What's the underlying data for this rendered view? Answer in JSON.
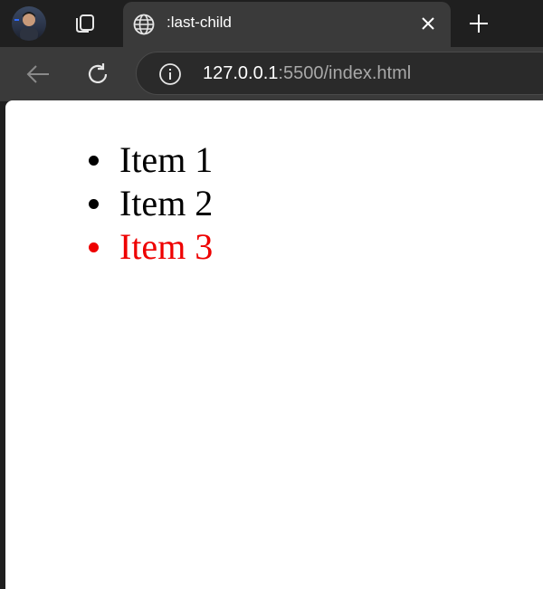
{
  "browser": {
    "tab": {
      "title": ":last-child"
    },
    "address_bar": {
      "host": "127.0.0.1",
      "rest": ":5500/index.html"
    }
  },
  "page": {
    "items": [
      "Item 1",
      "Item 2",
      "Item 3"
    ],
    "colors": {
      "default": "#000000",
      "last_child": "#ee0000"
    }
  },
  "icons": {
    "avatar": "profile-avatar",
    "tab_actions": "tab-actions-icon",
    "favicon": "globe-icon",
    "close": "close-icon",
    "new_tab": "plus-icon",
    "back": "back-arrow-icon",
    "reload": "reload-icon",
    "site_info": "info-icon"
  }
}
